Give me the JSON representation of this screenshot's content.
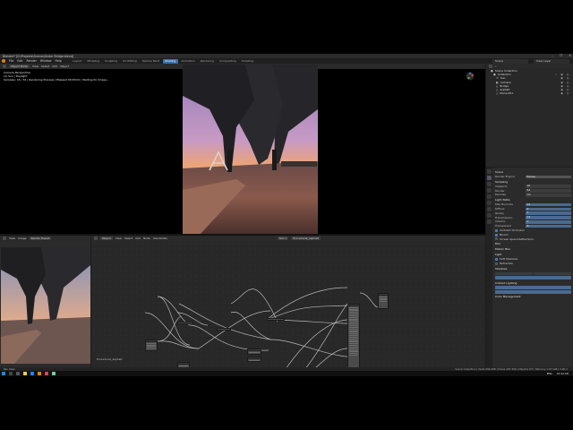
{
  "window": {
    "title": "Blender* [D:\\Projects\\Scenes\\Under Bridge.blend]",
    "controls": [
      "–",
      "❐",
      "✕"
    ]
  },
  "menubar": {
    "items": [
      "File",
      "Edit",
      "Render",
      "Window",
      "Help"
    ],
    "workspace_tabs": [
      "Layout",
      "Modeling",
      "Sculpting",
      "UV Editing",
      "Texture Paint",
      "Shading",
      "Animation",
      "Rendering",
      "Compositing",
      "Scripting"
    ],
    "active_tab": "Shading",
    "scene": "Scene",
    "view_layer": "View Layer"
  },
  "viewport": {
    "mode": "Object Mode",
    "header_items": [
      "View",
      "Select",
      "Add",
      "Object"
    ],
    "info_lines": [
      "Camera Perspective",
      "(1) Sun | Daylight",
      "Samples: 16 / 32 | Rendering Preview  | Elapsed 00:00:01 | Waiting for Image..."
    ]
  },
  "image_editor": {
    "header_items": [
      "View",
      "Image",
      "Render Result"
    ],
    "label": "Render Result"
  },
  "node_editor": {
    "header_items": [
      "Object",
      "View",
      "Select",
      "Add",
      "Node",
      "Use Nodes"
    ],
    "slot": "Slot 1",
    "material": "Procedural_asphalt",
    "footer_label": "Procedural_asphalt"
  },
  "outliner": {
    "title": "Scene Collection",
    "items": [
      {
        "label": "Collection",
        "indent": 0
      },
      {
        "label": "Sun",
        "indent": 1
      },
      {
        "label": "Camera",
        "indent": 1
      },
      {
        "label": "Bridge",
        "indent": 1
      },
      {
        "label": "asphalt",
        "indent": 1
      },
      {
        "label": "Plane.001",
        "indent": 1
      }
    ]
  },
  "properties": {
    "title": "Scene",
    "render_engine_label": "Render Engine",
    "render_engine": "Eevee",
    "sampling": "Sampling",
    "rows": [
      {
        "label": "Viewport",
        "value": "16"
      },
      {
        "label": "Render",
        "value": "64"
      },
      {
        "label": "Denoise",
        "value": "On"
      },
      {
        "label": "Light Paths",
        "value": ""
      },
      {
        "label": "Max Bounces",
        "value": "12"
      },
      {
        "label": "Diffuse",
        "value": "4"
      },
      {
        "label": "Glossy",
        "value": "4"
      },
      {
        "label": "Transmission",
        "value": "12"
      },
      {
        "label": "Volume",
        "value": "0"
      },
      {
        "label": "Transparent",
        "value": "8"
      }
    ],
    "subpanels": [
      "Film",
      "Motion Blur",
      "Light",
      "Shadows",
      "Indirect Lighting",
      "Color Management"
    ],
    "checks": [
      "Ambient Occlusion",
      "Bloom",
      "Screen Space Reflections",
      "Soft Shadows",
      "Refraction"
    ]
  },
  "status": {
    "left": "Pan View",
    "right": "Scene Collection | Verts 204,488 | Faces 187,300 | Objects 0/7 | Memory 1.07 GiB | 2.90.1"
  },
  "taskbar": {
    "time": "10:44 AM",
    "lang": "ENG"
  }
}
